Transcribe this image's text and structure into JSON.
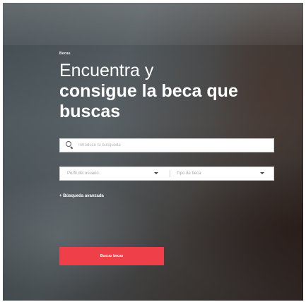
{
  "hero": {
    "eyebrow": "Becas",
    "headline": [
      "Encuentra y",
      "consigue la beca que",
      "buscas"
    ]
  },
  "search": {
    "icon": "search-icon",
    "placeholder": "Introduce tu búsqueda"
  },
  "filters": {
    "profile_label": "Perfil del usuario",
    "type_label": "Tipo de beca"
  },
  "advanced_search_label": "+ Búsqueda avanzada",
  "submit_label": "Buscar becas",
  "colors": {
    "accent": "#ef3f48",
    "text_on_image": "#ffffff"
  }
}
